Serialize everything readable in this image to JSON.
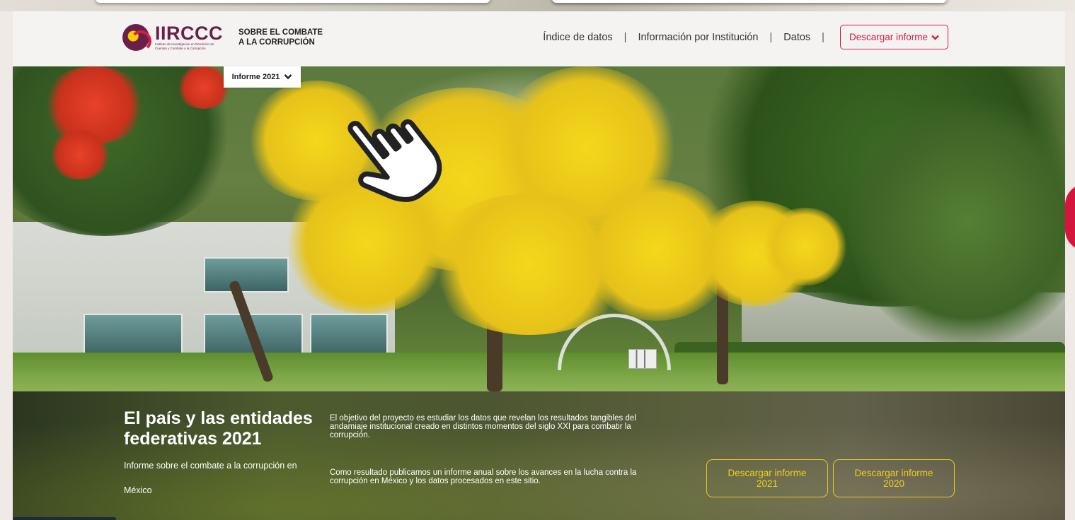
{
  "header": {
    "logo_text": "IIRCCC",
    "logo_subtitle": "Instituto de Investigación en Rendición de Cuentas y Combate a la Corrupción",
    "tagline_line1": "SOBRE EL COMBATE",
    "tagline_line2": "A LA CORRUPCIÓN",
    "nav": [
      {
        "label": "Índice de datos"
      },
      {
        "label": "Información por Institución"
      },
      {
        "label": "Datos"
      }
    ],
    "separator": "|",
    "download_label": "Descargar informe",
    "download_icon": "chevron-down-icon"
  },
  "report_selector": {
    "label": "Informe 2021",
    "icon": "chevron-down-icon"
  },
  "hero": {
    "title": "El país y las entidades federativas 2021",
    "subtitle_line1": "Informe sobre el combate a la corrupción en",
    "subtitle_line2": "México",
    "paragraph1": "El objetivo del proyecto es estudiar los datos que revelan los resultados tangibles del andamiaje institucional creado en distintos momentos del siglo XXI para combatir la corrupción.",
    "paragraph2": "Como resultado publicamos un informe anual sobre los avances en la lucha contra la corrupción en México y los datos procesados en este sitio.",
    "buttons": [
      {
        "label": "Descargar informe 2021"
      },
      {
        "label": "Descargar informe 2020"
      }
    ]
  },
  "colors": {
    "brand_purple": "#6a1f4a",
    "accent_red": "#cf1d45",
    "cta_yellow": "#f0cd22"
  },
  "cursor": "hand-pointer-icon"
}
